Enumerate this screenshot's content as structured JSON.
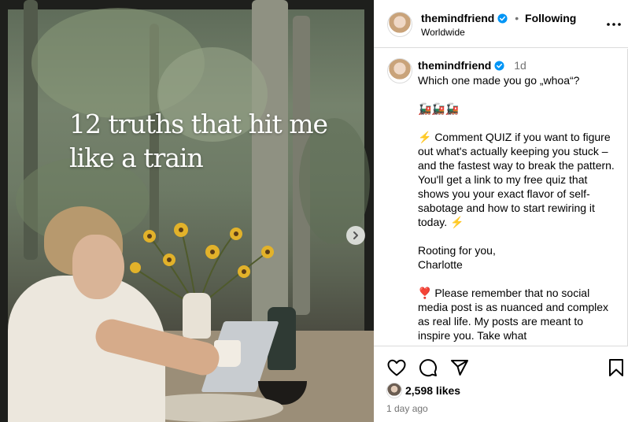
{
  "post": {
    "image_caption": "12 truths that hit me like a train"
  },
  "header": {
    "username": "themindfriend",
    "separator": "•",
    "follow_status": "Following",
    "location": "Worldwide"
  },
  "caption": {
    "username": "themindfriend",
    "age": "1d",
    "text": "Which one made you go „whoa“?\n\n🚂🚂🚂\n\n⚡ Comment QUIZ if you want to figure out what's actually keeping you stuck – and the fastest way to break the pattern. You'll get a link to my free quiz that shows you your exact flavor of self-sabotage and how to start rewiring it today. ⚡\n\nRooting for you,\nCharlotte\n\n❣️ Please remember that no social media post is as nuanced and complex as real life. My posts are meant to inspire you. Take what"
  },
  "engagement": {
    "likes": "2,598 likes",
    "date": "1 day ago"
  },
  "colors": {
    "verified": "#0095f6",
    "muted": "#737373",
    "border": "#dbdbdb"
  },
  "icons": [
    "heart-icon",
    "comment-icon",
    "share-icon",
    "bookmark-icon",
    "more-icon",
    "chevron-right-icon",
    "verified-badge-icon"
  ]
}
